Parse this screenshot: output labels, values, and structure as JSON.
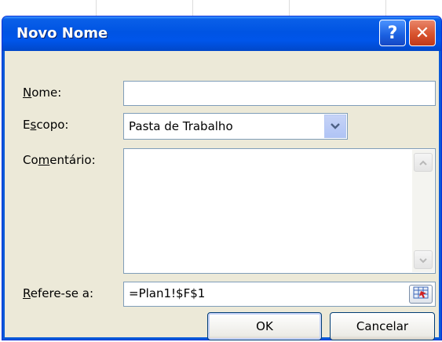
{
  "dialog": {
    "title": "Novo Nome",
    "help_glyph": "?",
    "close_glyph": "✕"
  },
  "form": {
    "nome": {
      "accel": "N",
      "rest": "ome:",
      "value": ""
    },
    "escopo": {
      "pre": "E",
      "accel": "s",
      "rest": "copo:",
      "value": "Pasta de Trabalho"
    },
    "comentario": {
      "pre": "Co",
      "accel": "m",
      "rest": "entário:",
      "value": ""
    },
    "refere": {
      "accel": "R",
      "rest": "efere-se a:",
      "value": "=Plan1!$F$1"
    }
  },
  "buttons": {
    "ok": "OK",
    "cancel": "Cancelar"
  },
  "icons": {
    "dropdown": "chevron-down-icon",
    "scroll_up": "scroll-up-arrow-icon",
    "scroll_down": "scroll-down-arrow-icon",
    "range_select": "range-select-icon"
  },
  "colors": {
    "titlebar": "#0054e3",
    "dialog_bg": "#ece9d8",
    "close_button": "#d8532e"
  }
}
